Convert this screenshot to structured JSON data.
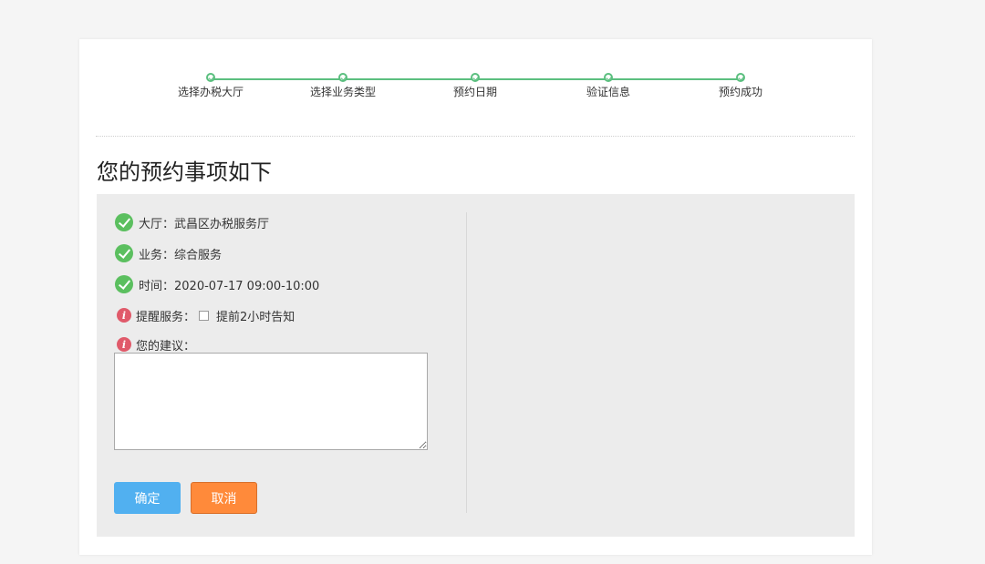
{
  "steps": [
    {
      "label": "选择办税大厅"
    },
    {
      "label": "选择业务类型"
    },
    {
      "label": "预约日期"
    },
    {
      "label": "验证信息"
    },
    {
      "label": "预约成功"
    }
  ],
  "page_title": "您的预约事项如下",
  "details": {
    "hall": "大厅：武昌区办税服务厅",
    "business": "业务：综合服务",
    "time": "时间：2020-07-17  09:00-10:00"
  },
  "reminder": {
    "label": "提醒服务：",
    "option": "提前2小时告知",
    "checked": false
  },
  "suggestion": {
    "label": "您的建议：",
    "value": ""
  },
  "buttons": {
    "confirm": "确定",
    "cancel": "取消"
  },
  "colors": {
    "step_green": "#5bbf7f",
    "ok_green": "#5bbf5f",
    "info_red": "#e05a6a",
    "confirm_blue": "#51b0f0",
    "cancel_orange": "#ff8a3a"
  }
}
